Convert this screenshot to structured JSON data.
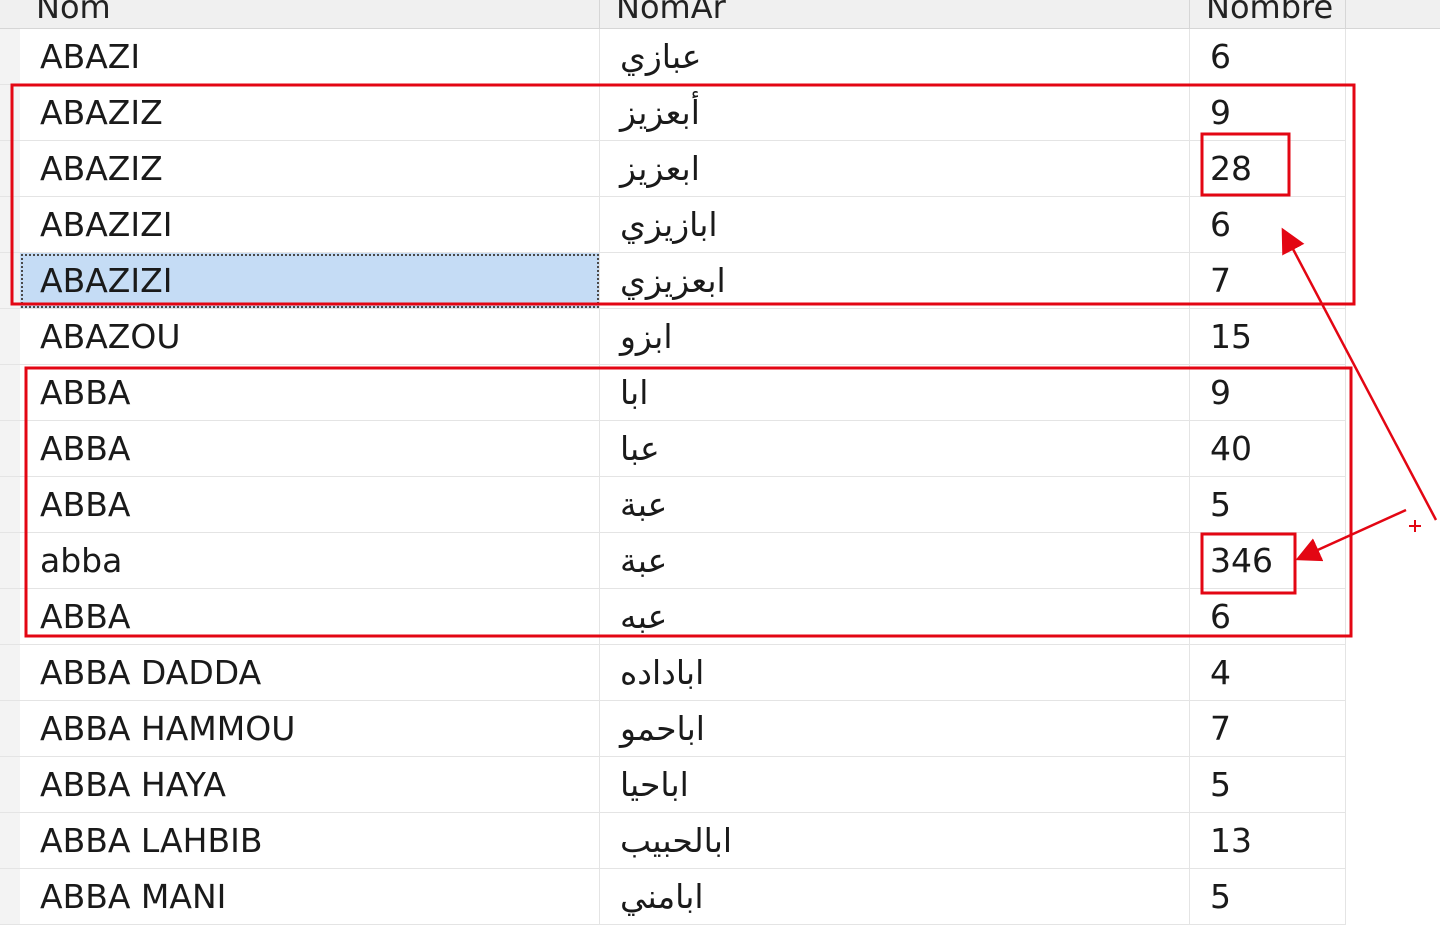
{
  "columns": {
    "nom": "Nom",
    "nomar": "NomAr",
    "nombre": "Nombre"
  },
  "rows": [
    {
      "nom": "ABAZI",
      "nomar": "عبازي",
      "nombre": "6"
    },
    {
      "nom": "ABAZIZ",
      "nomar": "أبعزيز",
      "nombre": "9"
    },
    {
      "nom": "ABAZIZ",
      "nomar": "ابعزيز",
      "nombre": "28"
    },
    {
      "nom": "ABAZIZI",
      "nomar": "ابازيزي",
      "nombre": "6"
    },
    {
      "nom": "ABAZIZI",
      "nomar": "ابعزيزي",
      "nombre": "7"
    },
    {
      "nom": "ABAZOU",
      "nomar": "ابزو",
      "nombre": "15"
    },
    {
      "nom": "ABBA",
      "nomar": "ابا",
      "nombre": "9"
    },
    {
      "nom": "ABBA",
      "nomar": "عبا",
      "nombre": "40"
    },
    {
      "nom": "ABBA",
      "nomar": "عبة",
      "nombre": "5"
    },
    {
      "nom": "abba",
      "nomar": "عبة",
      "nombre": "346"
    },
    {
      "nom": "ABBA",
      "nomar": "عبه",
      "nombre": "6"
    },
    {
      "nom": "ABBA DADDA",
      "nomar": "اباداده",
      "nombre": "4"
    },
    {
      "nom": "ABBA HAMMOU",
      "nomar": "اباحمو",
      "nombre": "7"
    },
    {
      "nom": "ABBA HAYA",
      "nomar": "اباحيا",
      "nombre": "5"
    },
    {
      "nom": "ABBA LAHBIB",
      "nomar": "ابالحبيب",
      "nombre": "13"
    },
    {
      "nom": "ABBA MANI",
      "nomar": "ابامني",
      "nombre": "5"
    }
  ],
  "selected_row_index": 4,
  "annotation_color": "#e30613"
}
